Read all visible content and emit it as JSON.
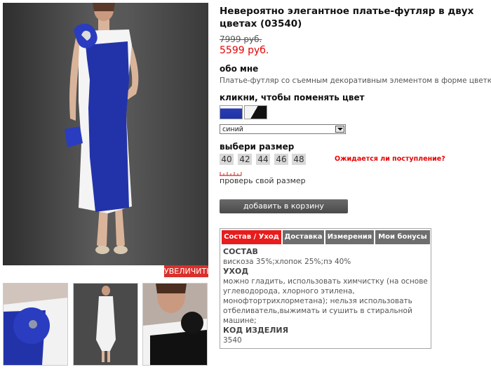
{
  "product": {
    "title": "Невероятно элегантное платье-футляр в двух цветах (03540)",
    "old_price": "7999 руб.",
    "new_price": "5599 руб."
  },
  "about": {
    "heading": "обо мне",
    "text": "Платье-футляр со съемным декоративным элементом в форме цветка."
  },
  "color": {
    "heading": "кликни, чтобы поменять цвет",
    "swatches": [
      "blue-white",
      "black-white"
    ],
    "selected": "синий"
  },
  "size": {
    "heading": "выбери размер",
    "options": [
      "40",
      "42",
      "44",
      "46",
      "48"
    ],
    "await_link": "Ожидается ли поступление?",
    "check_size": "проверь свой размер"
  },
  "cart": {
    "label": "добавить в корзину"
  },
  "gallery": {
    "zoom_label": "УВЕЛИЧИТЬ"
  },
  "tabs": {
    "items": [
      "Состав / Уход",
      "Доставка",
      "Измерения",
      "Мои бонусы"
    ],
    "active_index": 0
  },
  "composition": {
    "heading": "СОСТАВ",
    "text": "вискоза 35%;хлопок 25%;пэ 40%",
    "care_heading": "УХОД",
    "care_lines": [
      "можно гладить, использовать химчистку (на основе",
      "углеводорода, хлорного этилена,",
      "монофтортрихлорметана); нельзя использовать",
      "отбеливатель,выжимать и сушить в стиральной",
      "машине;"
    ],
    "code_heading": "КОД ИЗДЕЛИЯ",
    "code": "3540"
  },
  "colors": {
    "accent": "#e81c1c",
    "price": "#e60000",
    "dress_blue": "#2233aa"
  }
}
